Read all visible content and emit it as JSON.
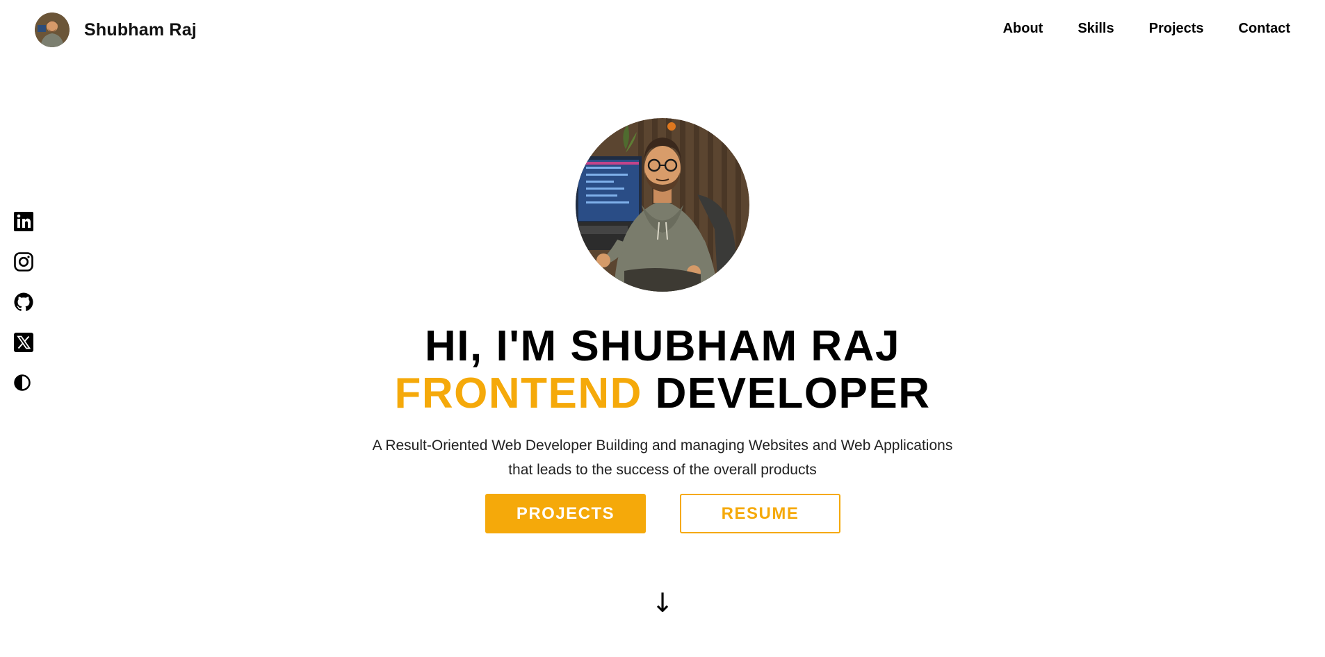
{
  "header": {
    "brand_name": "Shubham Raj",
    "nav": [
      {
        "label": "About"
      },
      {
        "label": "Skills"
      },
      {
        "label": "Projects"
      },
      {
        "label": "Contact"
      }
    ]
  },
  "social": [
    {
      "icon": "linkedin-icon"
    },
    {
      "icon": "instagram-icon"
    },
    {
      "icon": "github-icon"
    },
    {
      "icon": "x-twitter-icon"
    },
    {
      "icon": "theme-toggle-icon"
    }
  ],
  "hero": {
    "greeting": "HI, I'M SHUBHAM RAJ",
    "role_accent": "FRONTEND",
    "role_rest": "DEVELOPER",
    "description_line1": "A Result-Oriented Web Developer Building and managing Websites and Web Applications",
    "description_line2": "that leads to the success of the overall products",
    "primary_button": "PROJECTS",
    "secondary_button": "RESUME",
    "scroll_arrow": "↓"
  },
  "colors": {
    "accent": "#f5a90a",
    "text": "#000000",
    "background": "#ffffff"
  }
}
